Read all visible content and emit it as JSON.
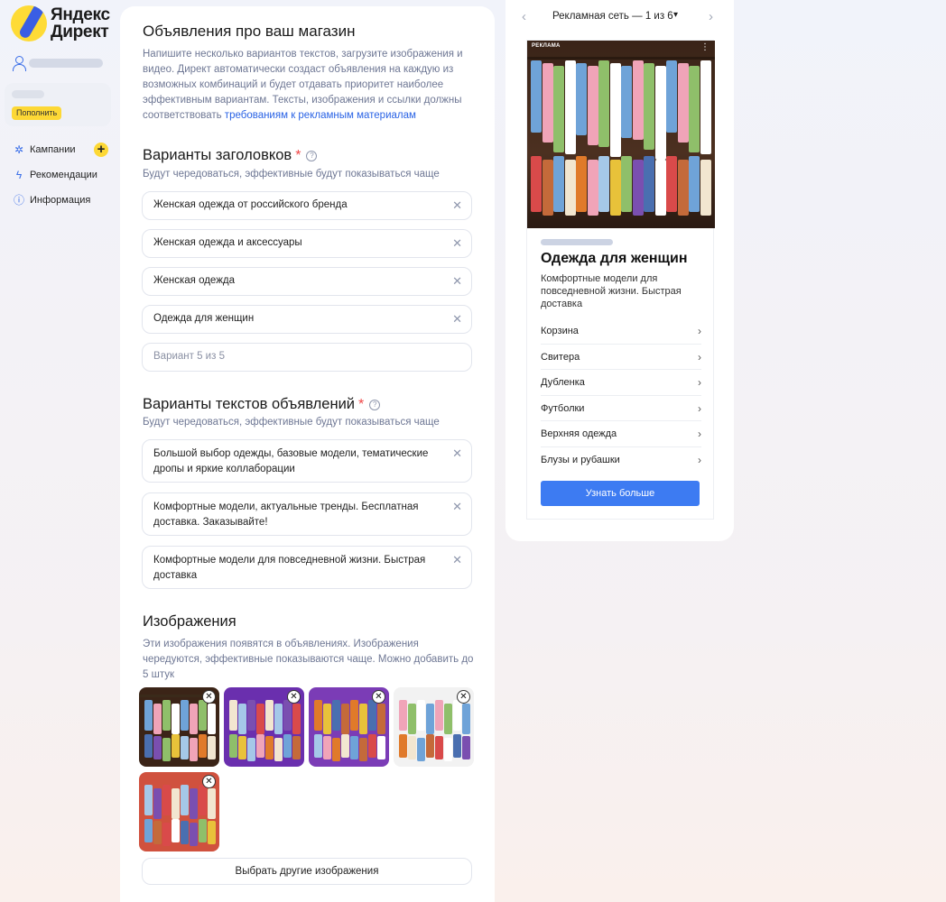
{
  "app": {
    "logo_line1": "Яндекс",
    "logo_line2": "Директ"
  },
  "sidebar": {
    "topup_label": "Пополнить",
    "items": [
      {
        "label": "Кампании",
        "icon": "campaigns-icon"
      },
      {
        "label": "Рекомендации",
        "icon": "lightning-icon"
      },
      {
        "label": "Информация",
        "icon": "info-icon"
      }
    ]
  },
  "form": {
    "title": "Объявления про ваш магазин",
    "description": "Напишите несколько вариантов текстов, загрузите изображения и видео. Директ автоматически создаст объявления на каждую из возможных комбинаций и будет отдавать приоритет наиболее эффективным вариантам. Тексты, изображения и ссылки должны соответствовать ",
    "description_link": "требованиям к рекламным материалам",
    "headlines": {
      "title": "Варианты заголовков",
      "required_mark": "*",
      "subtitle": "Будут чередоваться, эффективные будут показываться чаще",
      "values": [
        "Женская одежда от российского бренда",
        "Женская одежда и аксессуары",
        "Женская одежда",
        "Одежда для женщин"
      ],
      "placeholder": "Вариант 5 из 5"
    },
    "texts": {
      "title": "Варианты текстов объявлений",
      "required_mark": "*",
      "subtitle": "Будут чередоваться, эффективные будут показываться чаще",
      "values": [
        "Большой выбор одежды, базовые модели, тематические дропы и яркие коллаборации",
        "Комфортные модели, актуальные тренды. Бесплатная доставка. Заказывайте!",
        "Комфортные модели для повседневной жизни. Быстрая доставка"
      ]
    },
    "images": {
      "title": "Изображения",
      "subtitle": "Эти изображения появятся в объявлениях. Изображения чередуются, эффективные показываются чаще. Можно добавить до 5 штук",
      "thumb_backgrounds": [
        "#3b2417",
        "#6a2fae",
        "#7b3cb6",
        "#f2f2f2",
        "#d0513e"
      ],
      "pick_label": "Выбрать другие изображения"
    }
  },
  "preview": {
    "nav_title": "Рекламная сеть — 1 из 6",
    "ad_label": "РЕКЛАМА",
    "ad_title": "Одежда для женщин",
    "ad_text": "Комфортные модели для повседневной жизни. Быстрая доставка",
    "links": [
      "Корзина",
      "Свитера",
      "Дубленка",
      "Футболки",
      "Верхняя одежда",
      "Блузы и рубашки"
    ],
    "cta_label": "Узнать больше",
    "accent_color": "#3d7bf2"
  }
}
